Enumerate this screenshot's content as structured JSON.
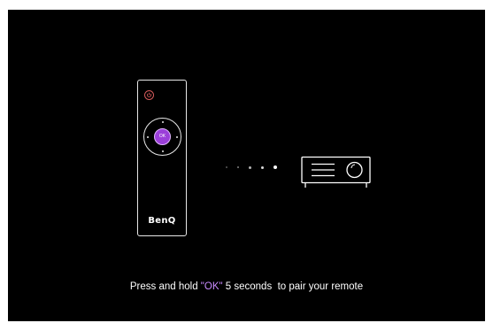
{
  "remote": {
    "ok_label": "OK",
    "brand": "BenQ",
    "icons": [
      "power-icon"
    ]
  },
  "pairing_progress": {
    "total_steps": 5,
    "active_step": 5
  },
  "projector": {
    "icon": "projector-icon"
  },
  "instruction": {
    "prefix": "Press and hold ",
    "key": "\"OK\"",
    "middle": " 5 seconds ",
    "suffix": " to pair your remote"
  },
  "colors": {
    "background": "#000000",
    "accent": "#9b3fd9",
    "highlight_text": "#c98bff",
    "power": "#d45a5a"
  }
}
